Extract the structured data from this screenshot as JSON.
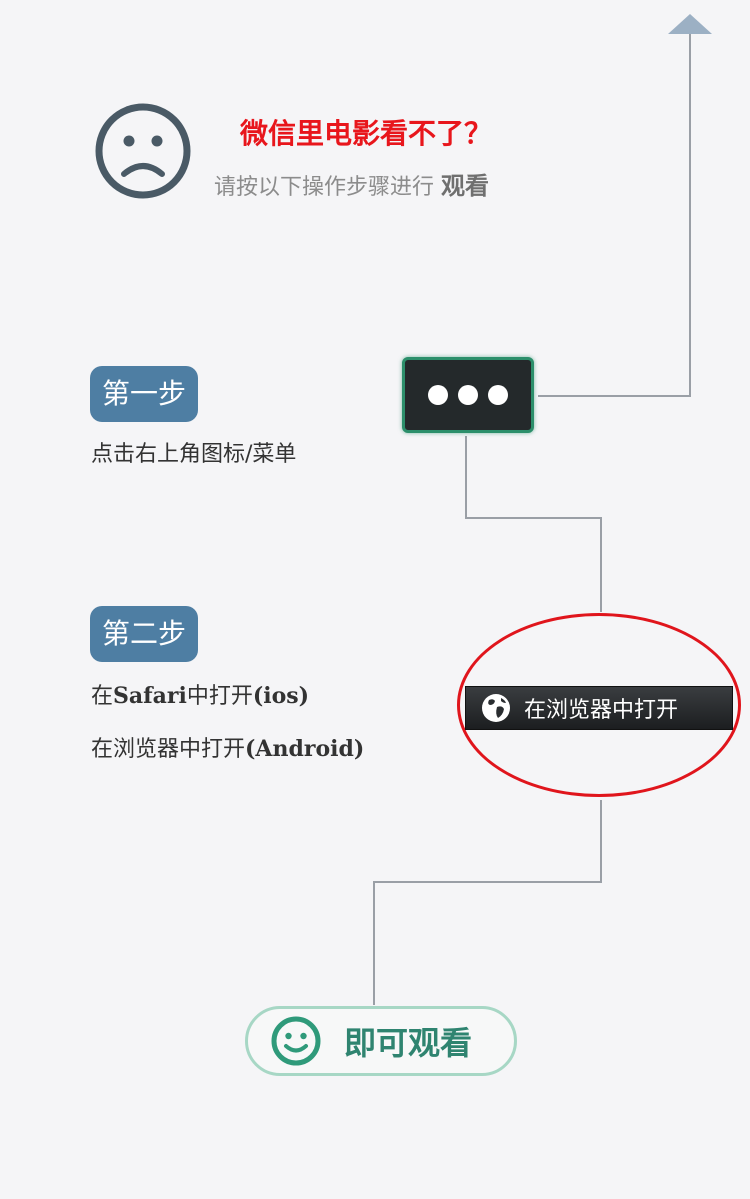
{
  "header": {
    "title": "微信里电影看不了？",
    "subtitle": "请按以下操作步骤进行",
    "subtitle_emphasis": "观看",
    "icon": "sad-face-icon"
  },
  "steps": [
    {
      "badge": "第一步",
      "lines": [
        "点击右上角图标/菜单"
      ]
    },
    {
      "badge": "第二步",
      "lines": [
        {
          "prefix": "在",
          "latin": "Safari",
          "mid": "中打开",
          "suffix": "(ios)"
        },
        {
          "prefix": "在浏览器中打开",
          "latin": "(Android)"
        }
      ]
    }
  ],
  "more_button": {
    "icon": "more-dots-icon"
  },
  "browser_button": {
    "label": "在浏览器中打开",
    "icon": "globe-icon"
  },
  "finish": {
    "label": "即可观看",
    "icon": "happy-face-icon"
  },
  "colors": {
    "title_red": "#e8161c",
    "badge_blue": "#4e7ea3",
    "highlight_red": "#e0151c",
    "finish_green": "#2f8470",
    "line_gray": "#9a9fa6",
    "arrow_blue": "#9cb0c4"
  }
}
